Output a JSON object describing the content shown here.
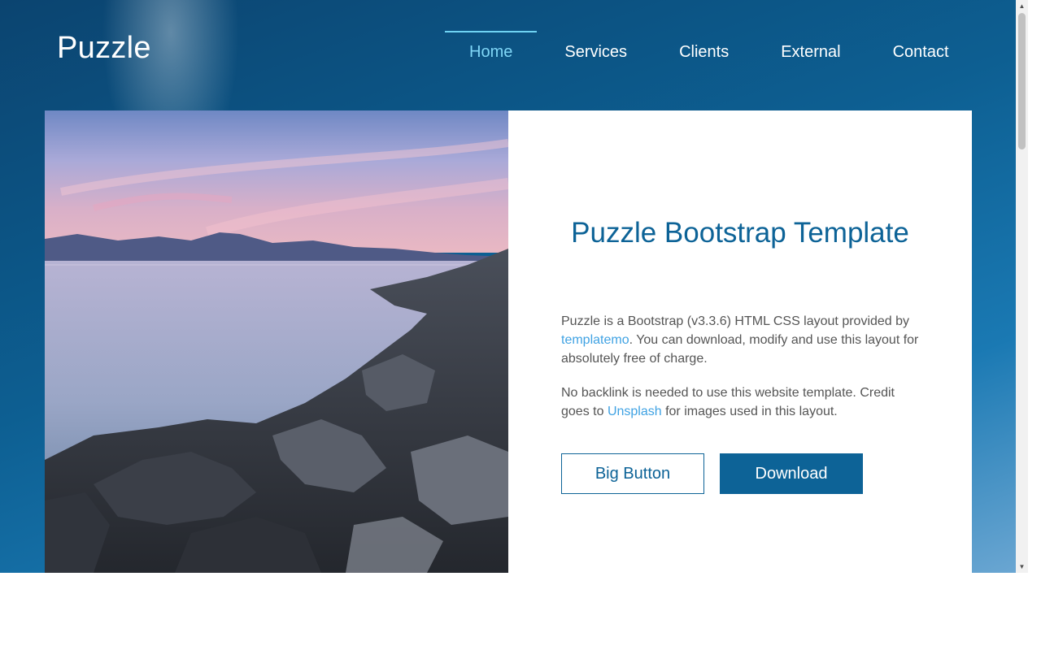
{
  "brand": {
    "name": "Puzzle"
  },
  "nav": {
    "items": [
      {
        "label": "Home",
        "active": true
      },
      {
        "label": "Services",
        "active": false
      },
      {
        "label": "Clients",
        "active": false
      },
      {
        "label": "External",
        "active": false
      },
      {
        "label": "Contact",
        "active": false
      }
    ]
  },
  "hero": {
    "image_icon": "sea-sunset-rocks-photo"
  },
  "main": {
    "title": "Puzzle Bootstrap Template",
    "paragraph1": {
      "before": "Puzzle is a Bootstrap (v3.3.6) HTML CSS layout provided by ",
      "link": "templatemo",
      "after": ". You can download, modify and use this layout for absolutely free of charge."
    },
    "paragraph2": {
      "before": "No backlink is needed to use this website template. Credit goes to ",
      "link": "Unsplash",
      "after": " for images used in this layout."
    },
    "buttons": {
      "big": "Big Button",
      "download": "Download"
    }
  },
  "scrollbar": {
    "up_icon": "▲",
    "down_icon": "▼"
  },
  "colors": {
    "brand_blue": "#0d6397",
    "active_nav": "#7fd6f6",
    "link": "#3fa2e3",
    "header_bg": "#0b4470"
  }
}
